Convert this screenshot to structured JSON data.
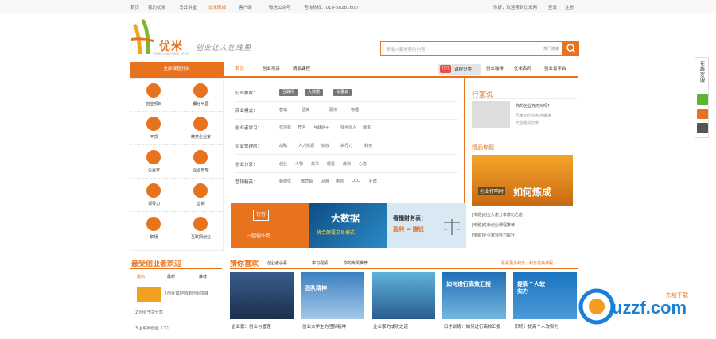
{
  "topbar": {
    "items": [
      "首页",
      "我的优米",
      "马云讲堂",
      "优米商城",
      "客户端",
      "微信公众号",
      "咨询热线：010-58281600"
    ],
    "right_items": [
      "你好，欢迎来到优米网",
      "登录",
      "注册"
    ]
  },
  "logo": {
    "name": "优米",
    "sub": "YOUMI.CN  SINCE 2010",
    "slogan": "创业让人在线里"
  },
  "search": {
    "placeholder": "请输入要搜索的内容",
    "hot": "热门搜索"
  },
  "nav": {
    "left_label": "全部课程分类",
    "items": [
      "首页",
      "创业项目",
      "精品课程"
    ],
    "category_button": "课程分类",
    "category_icon_text": "行行",
    "right_items": [
      "创业咖啡",
      "优米名师",
      "创业云平台"
    ]
  },
  "side_menu": [
    {
      "label": "创业项目",
      "icon": "target-icon",
      "color": "#e8731f"
    },
    {
      "label": "赢在中国",
      "icon": "rocket-icon",
      "color": "#e8731f"
    },
    {
      "label": "干货",
      "icon": "stack-icon",
      "color": "#e8731f"
    },
    {
      "label": "精英企业家",
      "icon": "edit-icon",
      "color": "#e8731f"
    },
    {
      "label": "企业家",
      "icon": "board-icon",
      "color": "#e8731f"
    },
    {
      "label": "企业管理",
      "icon": "chart-icon",
      "color": "#e8731f"
    },
    {
      "label": "领导力",
      "icon": "people-icon",
      "color": "#e8731f"
    },
    {
      "label": "营销",
      "icon": "coin-icon",
      "color": "#e8731f"
    },
    {
      "label": "职场",
      "icon": "briefcase-icon",
      "color": "#e8731f"
    },
    {
      "label": "互联网创业",
      "icon": "pin-icon",
      "color": "#e8731f"
    }
  ],
  "filters": [
    {
      "label": "行业推荐：",
      "tags": [
        "互联网",
        "大数据",
        "私董会"
      ],
      "opts": []
    },
    {
      "label": "商业模式：",
      "tags": [],
      "opts": [
        "营销",
        "品牌",
        "融资",
        "管理"
      ]
    },
    {
      "label": "创业者学习：",
      "tags": [],
      "opts": [
        "找项目",
        "开店",
        "互联网+",
        "找合伙人",
        "融资"
      ]
    },
    {
      "label": "企业管理层：",
      "tags": [],
      "opts": [
        "战略",
        "人力资源",
        "绩效",
        "执行力",
        "财务"
      ]
    },
    {
      "label": "创业分享：",
      "tags": [],
      "opts": [
        "创业",
        "人物",
        "故事",
        "经验",
        "教训",
        "心态"
      ]
    },
    {
      "label": "营销精英：",
      "tags": [],
      "opts": [
        "新媒体",
        "微营销",
        "品牌",
        "电商",
        "O2O",
        "社群"
      ]
    }
  ],
  "banner": {
    "seg1_tag": "行行",
    "seg1_text": "一起创业吧",
    "seg2_title": "大数据",
    "seg2_sub": "将会颠覆交易模式",
    "seg3_title": "看懂财务表：",
    "seg3_sub": "盈利 = 赚钱"
  },
  "right": {
    "title": "行家说",
    "item_title": "你的创业方向对吗？",
    "item_lines": [
      "行家对创业热点解读",
      "商业模式创新"
    ],
    "section2": "精品专题",
    "promo_text": "创业打响时",
    "promo_big": "如何炼成",
    "topic_lines": [
      "[专题]创业大佬分享成功之道",
      "[专题]优米创业课程推荐",
      "[专题]企业家领导力提升"
    ]
  },
  "bottom": {
    "left_title": "最受创业者欢迎",
    "left_tabs": [
      "最热",
      "最新",
      "推荐"
    ],
    "left_items": [
      "[创业]如何找到创业项目",
      "2 创业干货分享",
      "3 互联网创业（下）"
    ],
    "main_title": "猜你喜欢",
    "main_tabs": [
      "创业者必看",
      "学习视频",
      "你的专属推荐"
    ],
    "right_link": "看看更多积分，积分兑换课程",
    "cards": [
      {
        "title": "企业家：创业与管理",
        "overlay": ""
      },
      {
        "title": "创业大学生的团队精神",
        "overlay": "团队精神"
      },
      {
        "title": "企业家的成功之道",
        "overlay": ""
      },
      {
        "title": "口才训练：如何进行高效汇报",
        "overlay": "如何进行高效汇报"
      },
      {
        "title": "职场：提高个人软实力",
        "overlay": "提高个人软实力"
      }
    ]
  },
  "float_panel": {
    "title": "在线客服"
  },
  "watermark": {
    "text": "uzzf.com",
    "sub": "东坡下载"
  },
  "colors": {
    "accent": "#e8731f"
  }
}
